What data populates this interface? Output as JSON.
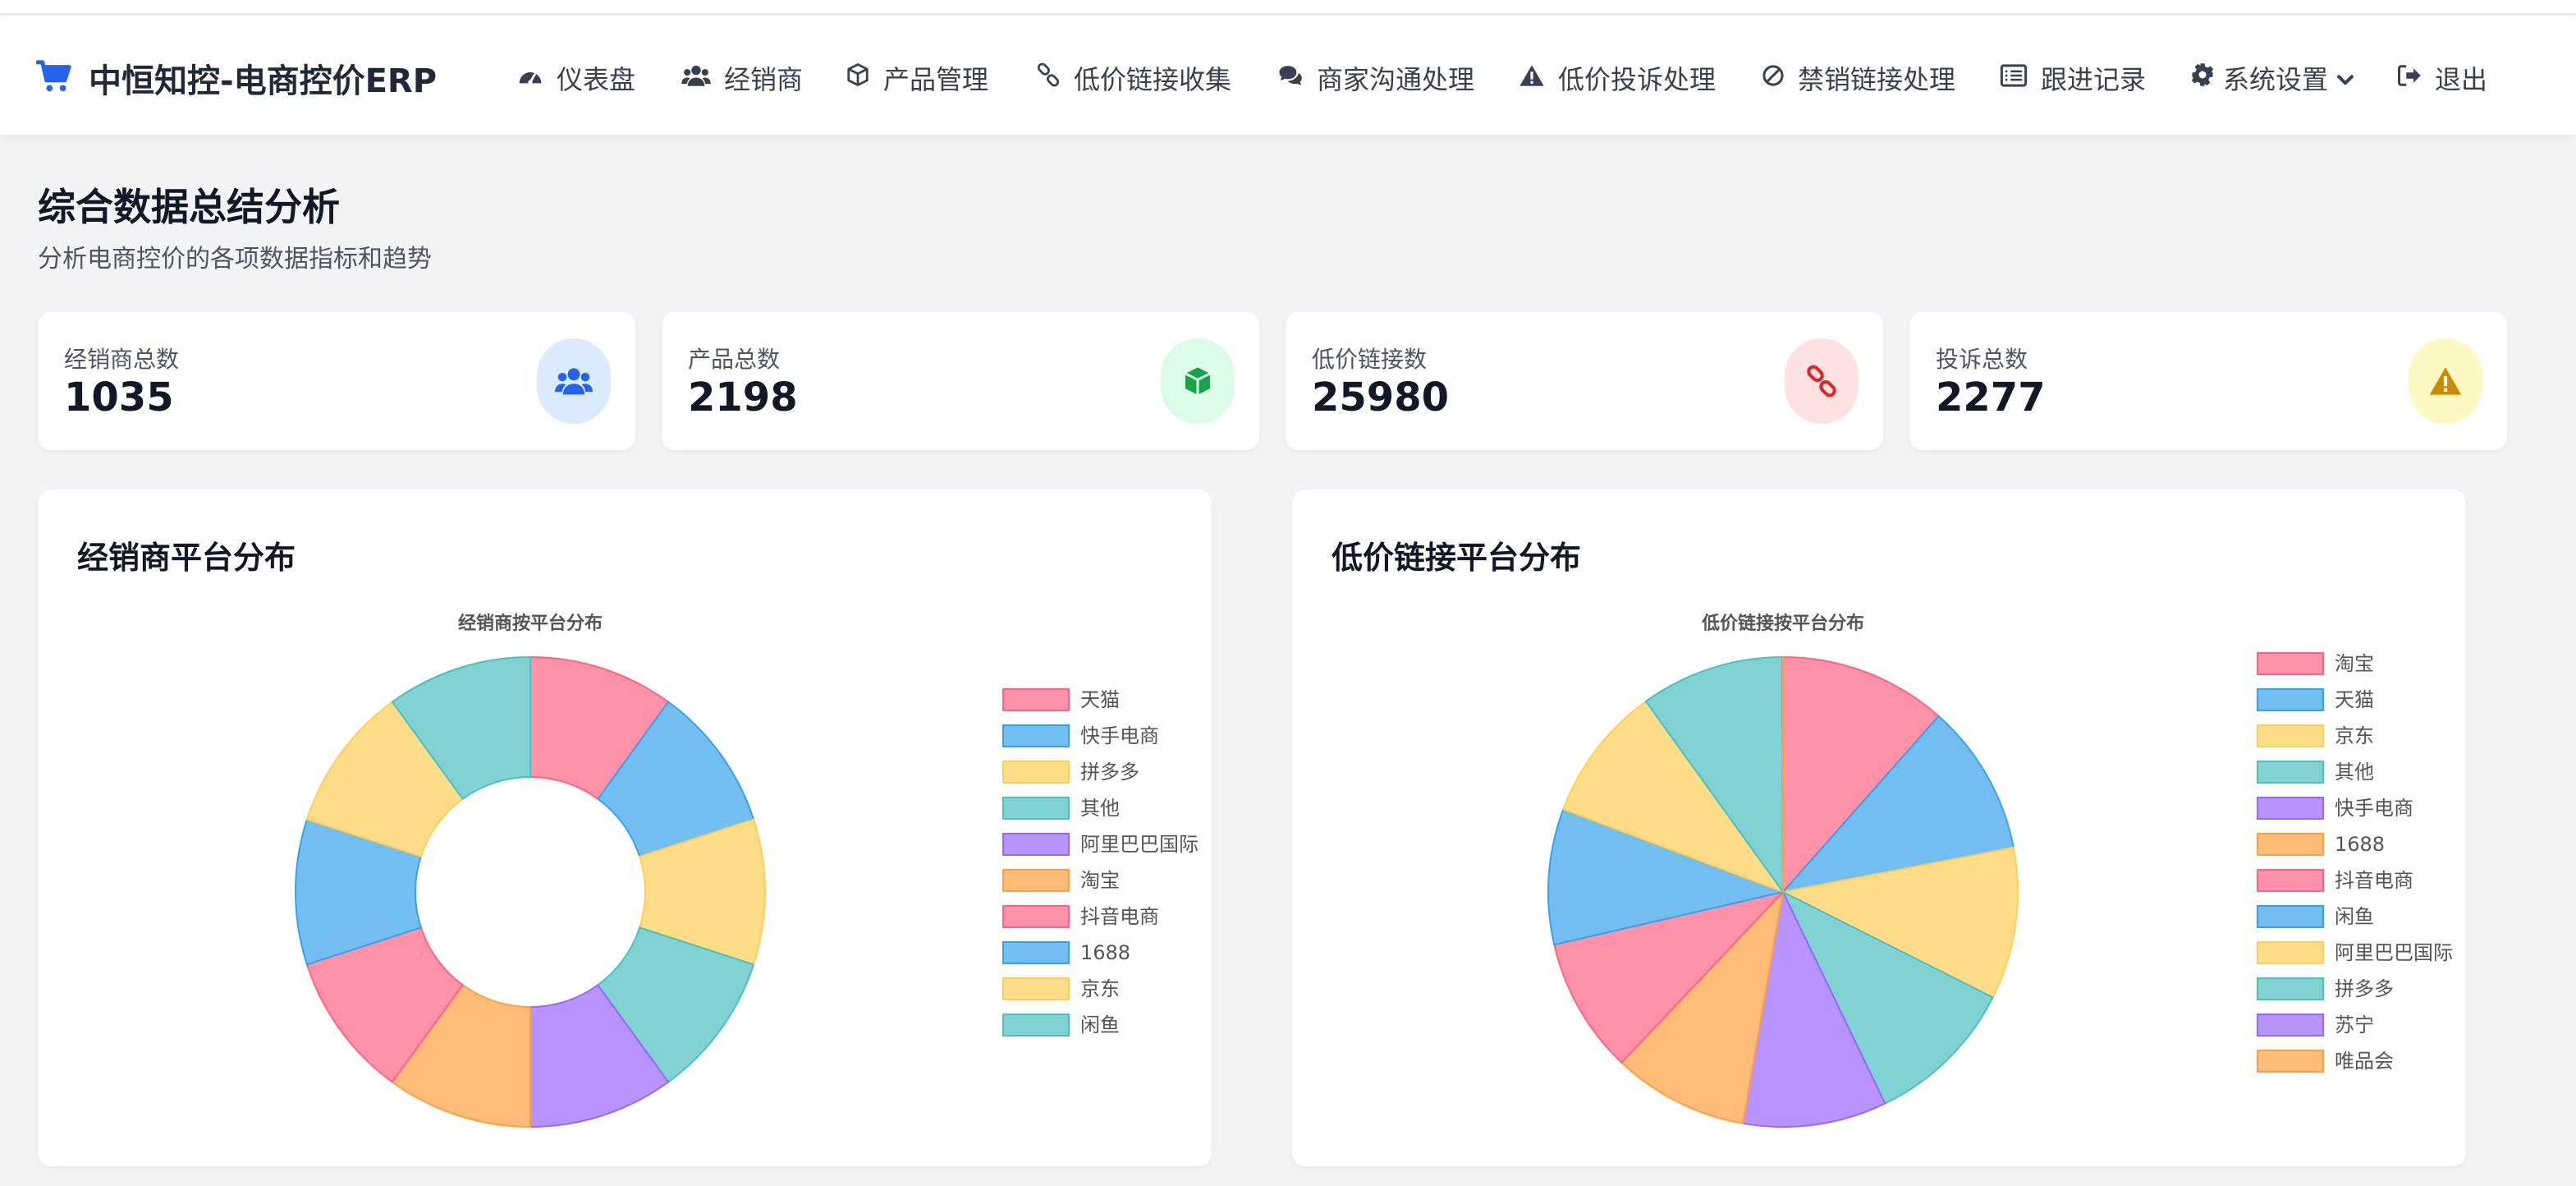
{
  "brand": {
    "title": "中恒知控-电商控价ERP",
    "icon": "shopping-cart-icon",
    "accent": "#2563eb"
  },
  "nav": [
    {
      "label": "仪表盘",
      "icon": "dashboard-gauge-icon"
    },
    {
      "label": "经销商",
      "icon": "users-icon"
    },
    {
      "label": "产品管理",
      "icon": "box-icon"
    },
    {
      "label": "低价链接收集",
      "icon": "link-icon"
    },
    {
      "label": "商家沟通处理",
      "icon": "comments-icon"
    },
    {
      "label": "低价投诉处理",
      "icon": "warning-icon"
    },
    {
      "label": "禁销链接处理",
      "icon": "ban-icon"
    },
    {
      "label": "跟进记录",
      "icon": "list-icon"
    },
    {
      "label": "系统设置",
      "icon": "gear-icon"
    },
    {
      "label": "退出",
      "icon": "sign-out-icon"
    }
  ],
  "page": {
    "title": "综合数据总结分析",
    "subtitle": "分析电商控价的各项数据指标和趋势"
  },
  "stats": [
    {
      "label": "经销商总数",
      "value": "1035",
      "icon": "users-icon",
      "bg": "#dbeafe",
      "color": "#2563eb"
    },
    {
      "label": "产品总数",
      "value": "2198",
      "icon": "box-icon",
      "bg": "#dcfce7",
      "color": "#16a34a"
    },
    {
      "label": "低价链接数",
      "value": "25980",
      "icon": "link-icon",
      "bg": "#fee2e2",
      "color": "#dc2626"
    },
    {
      "label": "投诉总数",
      "value": "2277",
      "icon": "warning-icon",
      "bg": "#fef9c3",
      "color": "#ca8a04"
    }
  ],
  "panels": [
    {
      "title": "经销商平台分布"
    },
    {
      "title": "低价链接平台分布"
    }
  ],
  "chart_data": [
    {
      "type": "pie",
      "variant": "doughnut",
      "title": "经销商按平台分布",
      "categories": [
        "天猫",
        "快手电商",
        "拼多多",
        "其他",
        "阿里巴巴国际",
        "淘宝",
        "抖音电商",
        "1688",
        "京东",
        "闲鱼"
      ],
      "values": [
        10,
        10,
        10,
        10,
        10,
        10,
        10,
        10,
        10,
        10
      ],
      "legend": "right",
      "colors": [
        "#ff6384",
        "#36a2eb",
        "#ffce56",
        "#4bc0c0",
        "#9966ff",
        "#ff9f40",
        "#ff6384",
        "#36a2eb",
        "#ffce56",
        "#4bc0c0"
      ]
    },
    {
      "type": "pie",
      "title": "低价链接按平台分布",
      "categories": [
        "淘宝",
        "天猫",
        "京东",
        "其他",
        "快手电商",
        "1688",
        "抖音电商",
        "闲鱼",
        "阿里巴巴国际",
        "拼多多",
        "苏宁",
        "唯品会"
      ],
      "values": [
        10.5,
        9.5,
        9.5,
        9.5,
        9.0,
        8.5,
        8.5,
        8.5,
        8.5,
        9.0,
        0.02,
        0.02
      ],
      "legend": "right",
      "colors": [
        "#ff6384",
        "#36a2eb",
        "#ffce56",
        "#4bc0c0",
        "#9966ff",
        "#ff9f40",
        "#ff6384",
        "#36a2eb",
        "#ffce56",
        "#4bc0c0",
        "#9966ff",
        "#ff9f40"
      ]
    }
  ]
}
